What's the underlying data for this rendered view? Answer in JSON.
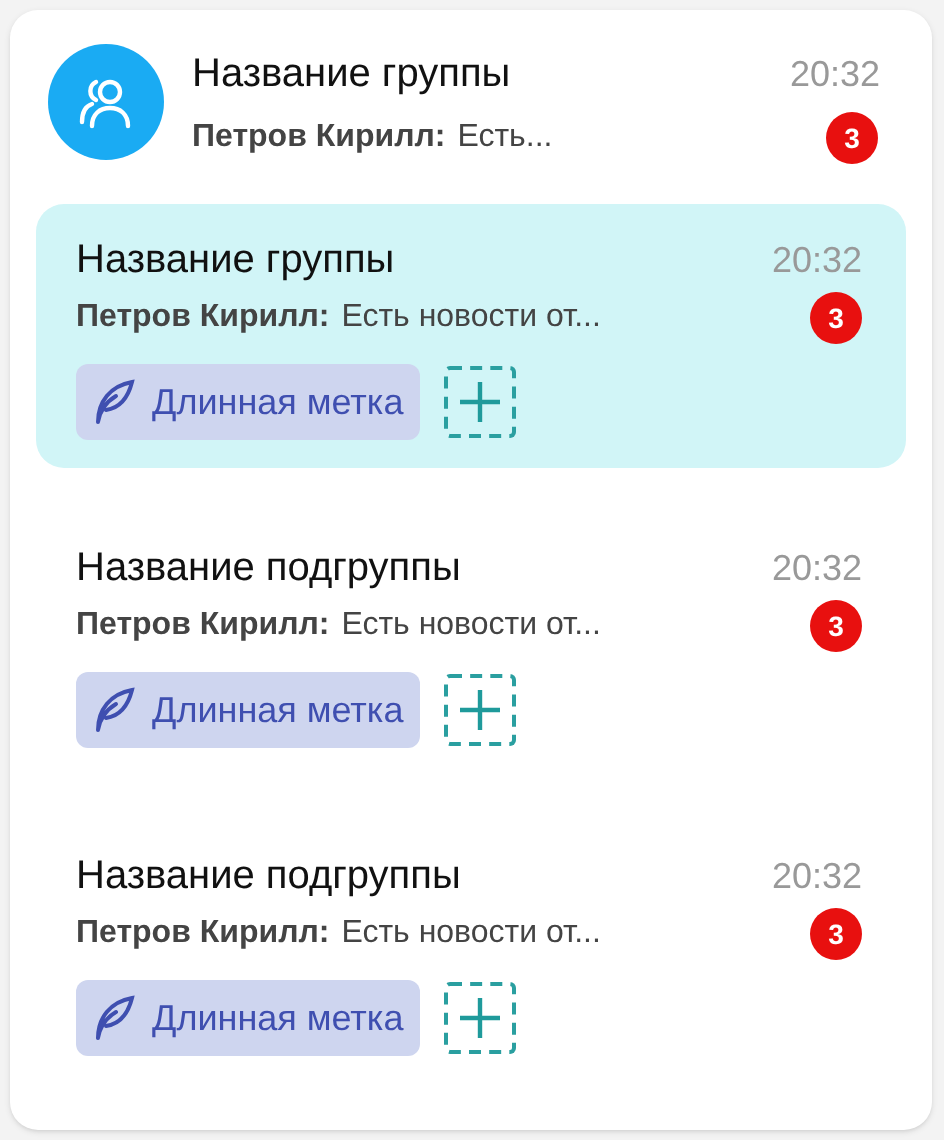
{
  "group": {
    "title": "Название группы",
    "time": "20:32",
    "sender": "Петров Кирилл:",
    "preview": "Есть...",
    "unread": "3"
  },
  "subgroups": [
    {
      "title": "Название группы",
      "time": "20:32",
      "sender": "Петров Кирилл:",
      "preview": "Есть новости от...",
      "unread": "3",
      "selected": true,
      "tag": "Длинная метка"
    },
    {
      "title": "Название подгруппы",
      "time": "20:32",
      "sender": "Петров Кирилл:",
      "preview": "Есть новости от...",
      "unread": "3",
      "selected": false,
      "tag": "Длинная метка"
    },
    {
      "title": "Название подгруппы",
      "time": "20:32",
      "sender": "Петров Кирилл:",
      "preview": "Есть новости от...",
      "unread": "3",
      "selected": false,
      "tag": "Длинная метка"
    }
  ]
}
